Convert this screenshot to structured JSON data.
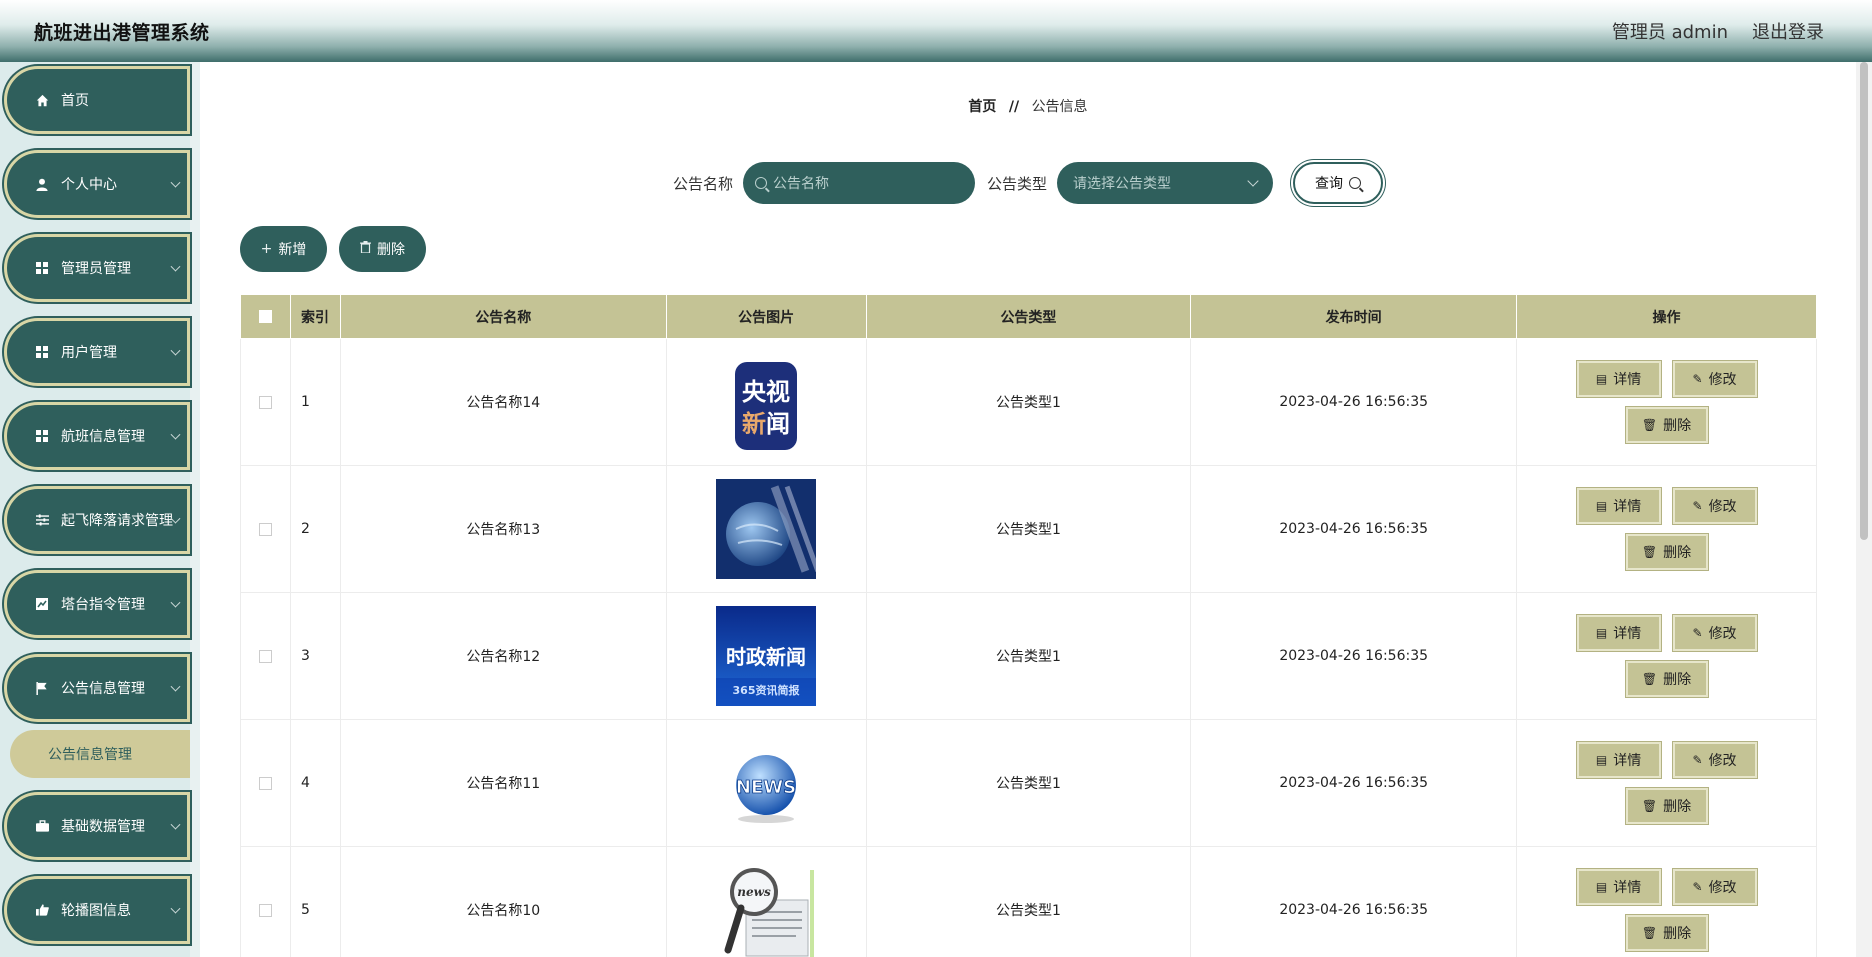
{
  "header": {
    "title": "航班进出港管理系统",
    "user": "管理员 admin",
    "logout": "退出登录"
  },
  "sidebar": {
    "items": [
      {
        "label": "首页",
        "icon": "home-icon",
        "glyph": "⌂",
        "has_arrow": false
      },
      {
        "label": "个人中心",
        "icon": "user-icon",
        "glyph": "●",
        "has_arrow": true
      },
      {
        "label": "管理员管理",
        "icon": "grid-icon",
        "glyph": "▦",
        "has_arrow": true
      },
      {
        "label": "用户管理",
        "icon": "grid-icon",
        "glyph": "▦",
        "has_arrow": true
      },
      {
        "label": "航班信息管理",
        "icon": "grid-icon",
        "glyph": "▦",
        "has_arrow": true
      },
      {
        "label": "起飞降落请求管理",
        "icon": "sliders-icon",
        "glyph": "☰",
        "has_arrow": true
      },
      {
        "label": "塔台指令管理",
        "icon": "chart-icon",
        "glyph": "▣",
        "has_arrow": true
      },
      {
        "label": "公告信息管理",
        "icon": "flag-icon",
        "glyph": "⚑",
        "has_arrow": true
      },
      {
        "label": "基础数据管理",
        "icon": "briefcase-icon",
        "glyph": "▤",
        "has_arrow": true
      },
      {
        "label": "轮播图信息",
        "icon": "thumbs-up-icon",
        "glyph": "▥",
        "has_arrow": true
      }
    ],
    "active_sub": "公告信息管理"
  },
  "breadcrumb": {
    "home": "首页",
    "sep": "//",
    "current": "公告信息"
  },
  "search": {
    "name_label": "公告名称",
    "name_placeholder": "公告名称",
    "type_label": "公告类型",
    "type_placeholder": "请选择公告类型",
    "query_label": "查询"
  },
  "actions": {
    "add": "新增",
    "delete": "删除"
  },
  "table": {
    "headers": [
      "索引",
      "公告名称",
      "公告图片",
      "公告类型",
      "发布时间",
      "操作"
    ],
    "rows": [
      {
        "index": "1",
        "name": "公告名称14",
        "type": "公告类型1",
        "time": "2023-04-26 16:56:35",
        "image": "cctv-news-logo"
      },
      {
        "index": "2",
        "name": "公告名称13",
        "type": "公告类型1",
        "time": "2023-04-26 16:56:35",
        "image": "globe-studio"
      },
      {
        "index": "3",
        "name": "公告名称12",
        "type": "公告类型1",
        "time": "2023-04-26 16:56:35",
        "image": "politics-news-banner"
      },
      {
        "index": "4",
        "name": "公告名称11",
        "type": "公告类型1",
        "time": "2023-04-26 16:56:35",
        "image": "news-globe"
      },
      {
        "index": "5",
        "name": "公告名称10",
        "type": "公告类型1",
        "time": "2023-04-26 16:56:35",
        "image": "news-magnifier"
      }
    ],
    "op_labels": {
      "detail": "详情",
      "edit": "修改",
      "delete": "删除"
    }
  },
  "images": {
    "cctv": {
      "line1": "央视",
      "line2a": "新",
      "line2b": "闻"
    },
    "politics": {
      "title": "时政新闻",
      "sub": "365资讯简报"
    },
    "globe": {
      "text": "NEWS"
    },
    "magnifier": {
      "text": "news"
    }
  },
  "colors": {
    "primary": "#2f5f5c",
    "accent": "#c4c395",
    "sub_active": "#cfca99"
  }
}
